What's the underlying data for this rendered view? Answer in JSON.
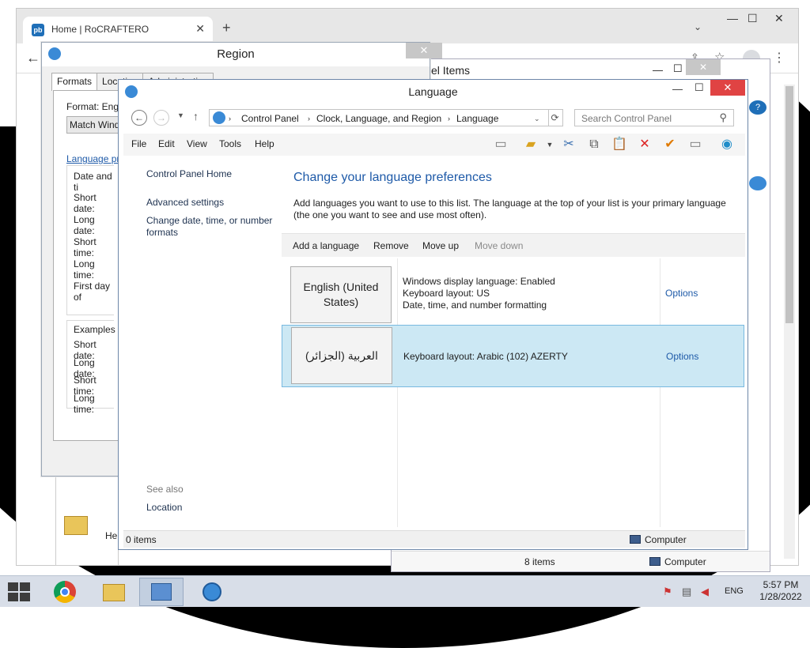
{
  "chrome": {
    "tab_title": "Home | RoCRAFTERO",
    "tab_close": "✕",
    "new_tab": "+"
  },
  "cp_back": {
    "title": "el Items",
    "status_items": "8 items",
    "status_computer": "Computer",
    "help_label": "He"
  },
  "region": {
    "title": "Region",
    "tabs": [
      "Formats",
      "Location",
      "Administrative"
    ],
    "format_label": "Format: Engl",
    "match_button": "Match Wind",
    "language_link": "Language pr",
    "date_time_group": "Date and ti",
    "rows": [
      "Short date:",
      "Long date:",
      "Short time:",
      "Long time:",
      "First day of"
    ],
    "examples_group": "Examples",
    "example_rows": [
      "Short date:",
      "Long date:",
      "Short time:",
      "Long time:"
    ]
  },
  "language_window": {
    "title": "Language",
    "breadcrumb": [
      "Control Panel",
      "Clock, Language, and Region",
      "Language"
    ],
    "search_placeholder": "Search Control Panel",
    "menu": [
      "File",
      "Edit",
      "View",
      "Tools",
      "Help"
    ],
    "sidebar": {
      "home": "Control Panel Home",
      "advanced": "Advanced settings",
      "change_formats": "Change date, time, or number formats",
      "see_also": "See also",
      "location": "Location"
    },
    "heading": "Change your language preferences",
    "description": "Add languages you want to use to this list. The language at the top of your list is your primary language (the one you want to see and use most often).",
    "commands": {
      "add": "Add a language",
      "remove": "Remove",
      "move_up": "Move up",
      "move_down": "Move down"
    },
    "languages": [
      {
        "name": "English (United States)",
        "info": [
          "Windows display language: Enabled",
          "Keyboard layout: US",
          "Date, time, and number formatting"
        ],
        "options": "Options"
      },
      {
        "name": "العربية (الجزائر)",
        "info": [
          "Keyboard layout: Arabic (102) AZERTY"
        ],
        "options": "Options"
      }
    ],
    "status_items": "0 items",
    "status_computer": "Computer"
  },
  "taskbar": {
    "language": "ENG",
    "time": "5:57 PM",
    "date": "1/28/2022",
    "apps": [
      "start-icon",
      "chrome-icon",
      "file-explorer-icon",
      "control-panel-icon",
      "globe-icon"
    ]
  },
  "colors": {
    "accent_link": "#1e5aa8",
    "selected_row": "#cce8f4",
    "close_red": "#e04343"
  }
}
